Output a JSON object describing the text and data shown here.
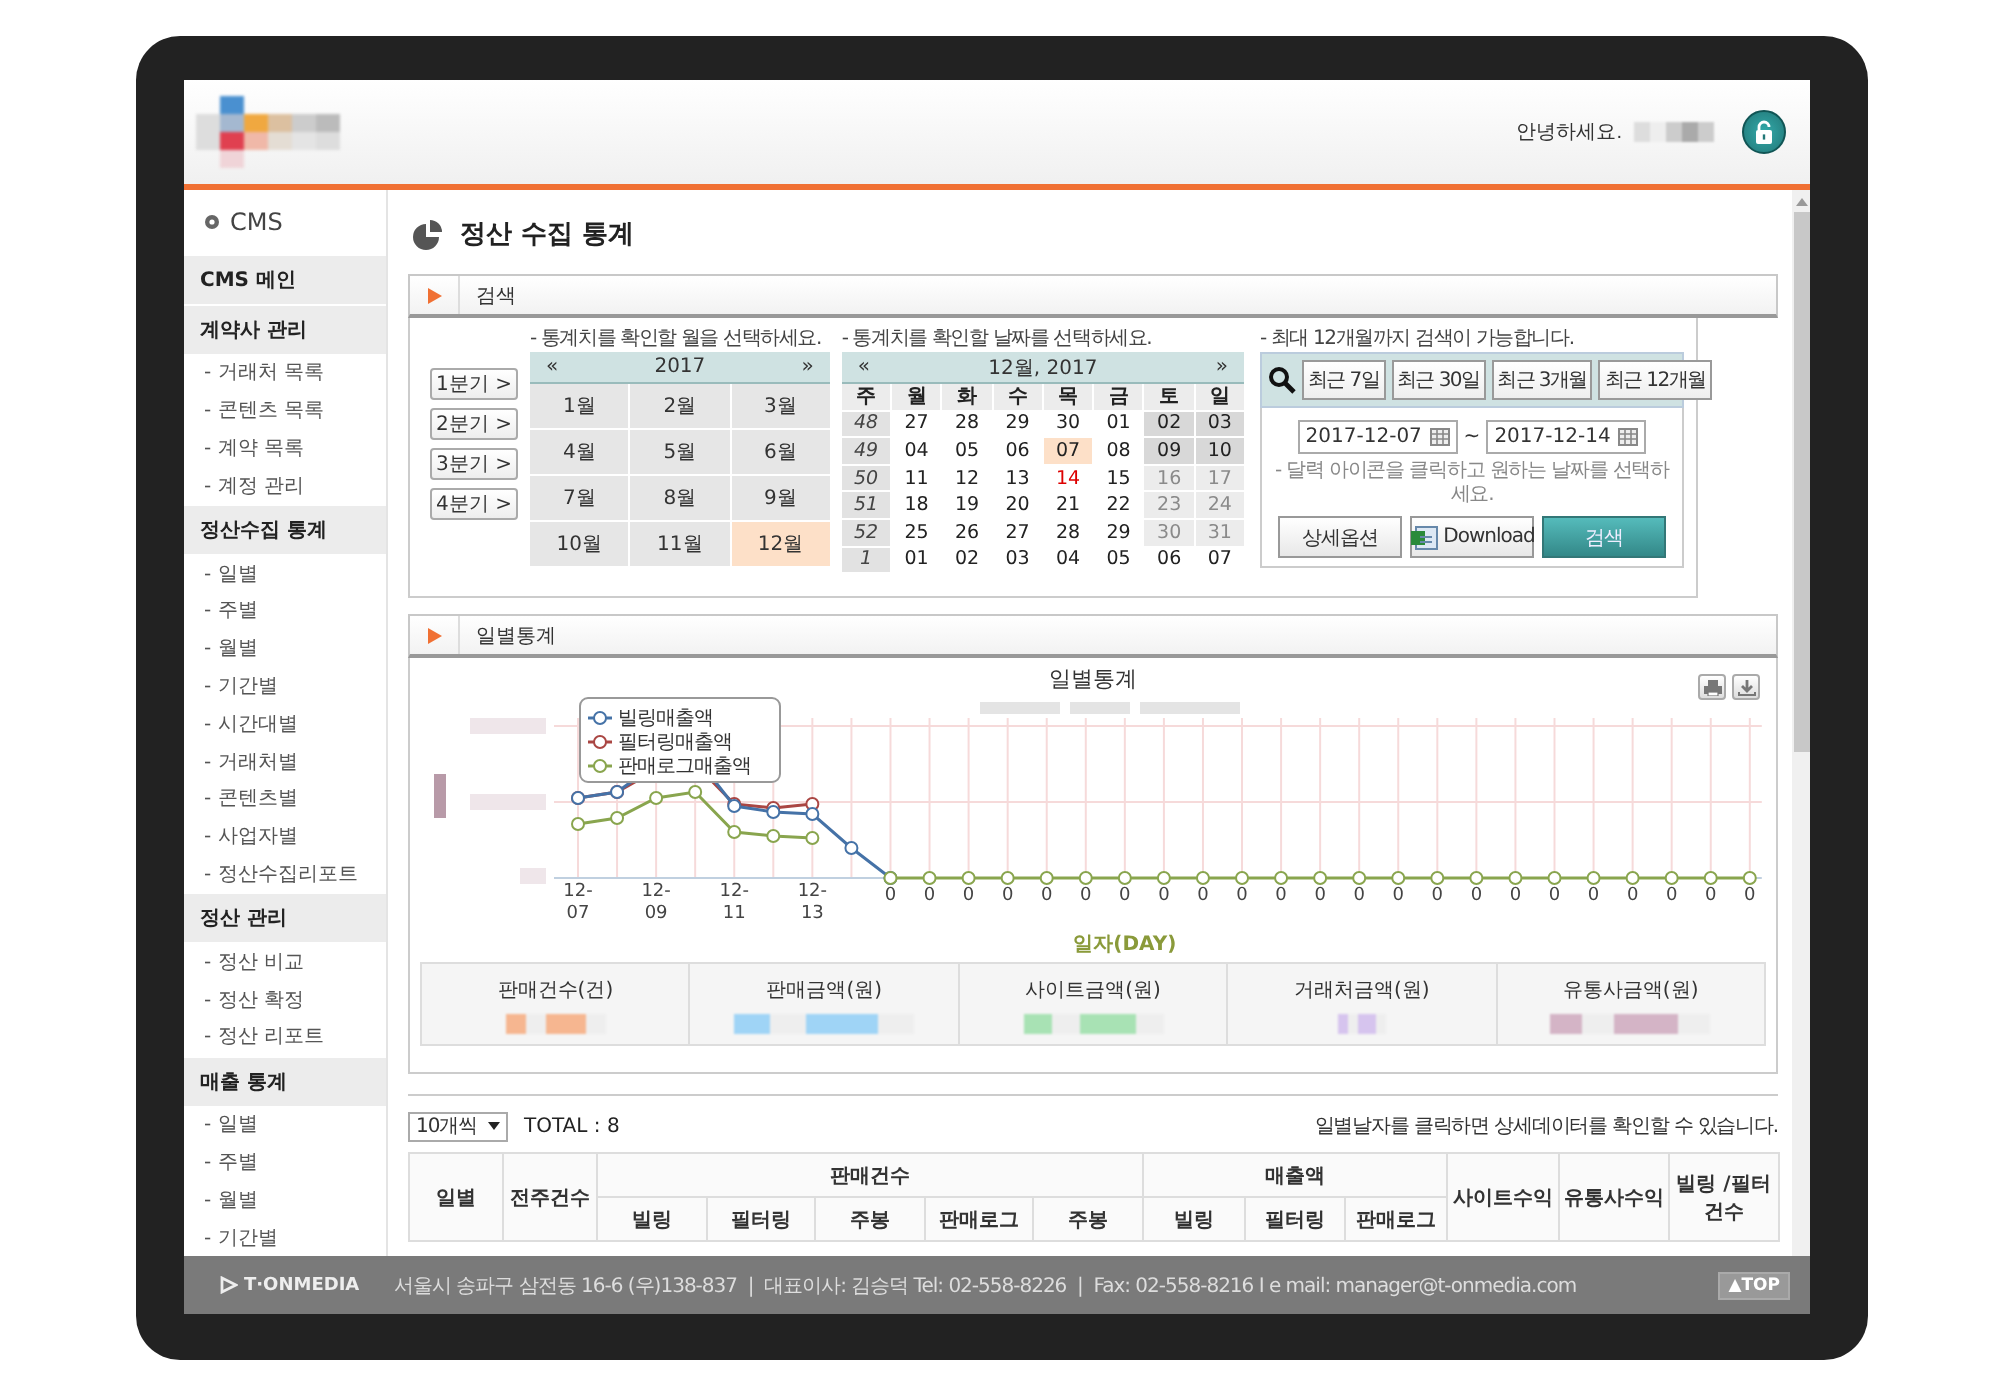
{
  "header": {
    "greeting": "안녕하세요."
  },
  "sidebar": {
    "title": "CMS",
    "sections": [
      {
        "label": "CMS 메인"
      },
      {
        "label": "계약사 관리",
        "children": [
          {
            "label": "- 거래처 목록"
          },
          {
            "label": "- 콘텐츠 목록"
          },
          {
            "label": "- 계약 목록"
          },
          {
            "label": "- 계정 관리"
          }
        ]
      },
      {
        "label": "정산수집 통계",
        "children": [
          {
            "label": "- 일별"
          },
          {
            "label": "- 주별"
          },
          {
            "label": "- 월별"
          },
          {
            "label": "- 기간별"
          },
          {
            "label": "- 시간대별"
          },
          {
            "label": "- 거래처별"
          },
          {
            "label": "- 콘텐츠별"
          },
          {
            "label": "- 사업자별"
          },
          {
            "label": "- 정산수집리포트"
          }
        ]
      },
      {
        "label": "정산 관리",
        "children": [
          {
            "label": "- 정산 비교"
          },
          {
            "label": "- 정산 확정"
          },
          {
            "label": "- 정산 리포트"
          }
        ]
      },
      {
        "label": "매출 통계",
        "children": [
          {
            "label": "- 일별"
          },
          {
            "label": "- 주별"
          },
          {
            "label": "- 월별"
          },
          {
            "label": "- 기간별"
          }
        ]
      }
    ]
  },
  "page_title": "정산 수집 통계",
  "search": {
    "title": "검색",
    "month_hint": "- 통계치를 확인할 월을 선택하세요.",
    "quarters": [
      "1분기 >",
      "2분기 >",
      "3분기 >",
      "4분기 >"
    ],
    "year_picker": {
      "prev": "«",
      "label": "2017",
      "next": "»"
    },
    "months": [
      {
        "label": "1월",
        "selected": false
      },
      {
        "label": "2월",
        "selected": false
      },
      {
        "label": "3월",
        "selected": false
      },
      {
        "label": "4월",
        "selected": false
      },
      {
        "label": "5월",
        "selected": false
      },
      {
        "label": "6월",
        "selected": false
      },
      {
        "label": "7월",
        "selected": false
      },
      {
        "label": "8월",
        "selected": false
      },
      {
        "label": "9월",
        "selected": false
      },
      {
        "label": "10월",
        "selected": false
      },
      {
        "label": "11월",
        "selected": false
      },
      {
        "label": "12월",
        "selected": true
      }
    ],
    "date_hint": "- 통계치를 확인할 날짜를 선택하세요.",
    "calendar": {
      "prev": "«",
      "label": "12월, 2017",
      "next": "»",
      "weekdays": [
        "주",
        "월",
        "화",
        "수",
        "목",
        "금",
        "토",
        "일"
      ],
      "weeks": [
        {
          "number": "48",
          "days": [
            {
              "label": "27",
              "kind": "day",
              "selected": false,
              "today": false
            },
            {
              "label": "28",
              "kind": "day",
              "selected": false,
              "today": false
            },
            {
              "label": "29",
              "kind": "day",
              "selected": false,
              "today": false
            },
            {
              "label": "30",
              "kind": "day",
              "selected": false,
              "today": false
            },
            {
              "label": "01",
              "kind": "day",
              "selected": false,
              "today": false
            },
            {
              "label": "02",
              "kind": "weekend",
              "selected": false,
              "today": false
            },
            {
              "label": "03",
              "kind": "weekend",
              "selected": false,
              "today": false
            }
          ]
        },
        {
          "number": "49",
          "days": [
            {
              "label": "04",
              "kind": "day",
              "selected": false,
              "today": false
            },
            {
              "label": "05",
              "kind": "day",
              "selected": false,
              "today": false
            },
            {
              "label": "06",
              "kind": "day",
              "selected": false,
              "today": false
            },
            {
              "label": "07",
              "kind": "day",
              "selected": true,
              "today": false
            },
            {
              "label": "08",
              "kind": "day",
              "selected": false,
              "today": false
            },
            {
              "label": "09",
              "kind": "weekend",
              "selected": false,
              "today": false
            },
            {
              "label": "10",
              "kind": "weekend",
              "selected": false,
              "today": false
            }
          ]
        },
        {
          "number": "50",
          "days": [
            {
              "label": "11",
              "kind": "day",
              "selected": false,
              "today": false
            },
            {
              "label": "12",
              "kind": "day",
              "selected": false,
              "today": false
            },
            {
              "label": "13",
              "kind": "day",
              "selected": false,
              "today": false
            },
            {
              "label": "14",
              "kind": "day",
              "selected": false,
              "today": true
            },
            {
              "label": "15",
              "kind": "day",
              "selected": false,
              "today": false
            },
            {
              "label": "16",
              "kind": "disabled",
              "selected": false,
              "today": false
            },
            {
              "label": "17",
              "kind": "disabled",
              "selected": false,
              "today": false
            }
          ]
        },
        {
          "number": "51",
          "days": [
            {
              "label": "18",
              "kind": "day",
              "selected": false,
              "today": false
            },
            {
              "label": "19",
              "kind": "day",
              "selected": false,
              "today": false
            },
            {
              "label": "20",
              "kind": "day",
              "selected": false,
              "today": false
            },
            {
              "label": "21",
              "kind": "day",
              "selected": false,
              "today": false
            },
            {
              "label": "22",
              "kind": "day",
              "selected": false,
              "today": false
            },
            {
              "label": "23",
              "kind": "disabled",
              "selected": false,
              "today": false
            },
            {
              "label": "24",
              "kind": "disabled",
              "selected": false,
              "today": false
            }
          ]
        },
        {
          "number": "52",
          "days": [
            {
              "label": "25",
              "kind": "day",
              "selected": false,
              "today": false
            },
            {
              "label": "26",
              "kind": "day",
              "selected": false,
              "today": false
            },
            {
              "label": "27",
              "kind": "day",
              "selected": false,
              "today": false
            },
            {
              "label": "28",
              "kind": "day",
              "selected": false,
              "today": false
            },
            {
              "label": "29",
              "kind": "day",
              "selected": false,
              "today": false
            },
            {
              "label": "30",
              "kind": "disabled",
              "selected": false,
              "today": false
            },
            {
              "label": "31",
              "kind": "disabled",
              "selected": false,
              "today": false
            }
          ]
        },
        {
          "number": "1",
          "days": [
            {
              "label": "01",
              "kind": "day",
              "selected": false,
              "today": false
            },
            {
              "label": "02",
              "kind": "day",
              "selected": false,
              "today": false
            },
            {
              "label": "03",
              "kind": "day",
              "selected": false,
              "today": false
            },
            {
              "label": "04",
              "kind": "day",
              "selected": false,
              "today": false
            },
            {
              "label": "05",
              "kind": "day",
              "selected": false,
              "today": false
            },
            {
              "label": "06",
              "kind": "day",
              "selected": false,
              "today": false
            },
            {
              "label": "07",
              "kind": "day",
              "selected": false,
              "today": false
            }
          ]
        }
      ]
    },
    "range_hint": "- 최대 12개월까지 검색이 가능합니다.",
    "presets": [
      "최근 7일",
      "최근 30일",
      "최근 3개월",
      "최근 12개월"
    ],
    "start_date": "2017-12-07",
    "separator": "~",
    "end_date": "2017-12-14",
    "picker_hint": "- 달력 아이콘을 클릭하고 원하는 날짜를 선택하세요.",
    "buttons": [
      {
        "label": "상세옵션",
        "kind": "plain"
      },
      {
        "label": "Download",
        "kind": "download"
      },
      {
        "label": "검색",
        "kind": "primary"
      }
    ]
  },
  "daily_stats": {
    "title": "일별통계",
    "chart": {
      "title": "일별통계",
      "legend": [
        {
          "name": "빌링매출액",
          "color": "#4572a7"
        },
        {
          "name": "필터링매출액",
          "color": "#aa4643"
        },
        {
          "name": "판매로그매출액",
          "color": "#89a54e"
        }
      ],
      "x_labels": [
        "12-07",
        "12-09",
        "12-11",
        "12-13"
      ],
      "point_labels": [
        "0",
        "0",
        "0",
        "0",
        "0",
        "0",
        "0",
        "0",
        "0",
        "0",
        "0",
        "0",
        "0",
        "0",
        "0",
        "0",
        "0",
        "0",
        "0",
        "0",
        "0",
        "0",
        "0"
      ],
      "xlabel": "일자(DAY)"
    },
    "summary": [
      {
        "label": "판매건수(건)",
        "color": "#f6b690"
      },
      {
        "label": "판매금액(원)",
        "color": "#9fd4f6"
      },
      {
        "label": "사이트금액(원)",
        "color": "#a8e2b4"
      },
      {
        "label": "거래처금액(원)",
        "color": "#d6c4ee"
      },
      {
        "label": "유통사금액(원)",
        "color": "#d4b4c6"
      }
    ]
  },
  "table": {
    "page_size": "10개씩",
    "total": "TOTAL : 8",
    "hint": "일별날자를 클릭하면 상세데이터를 확인할 수 있습니다.",
    "columns": [
      {
        "label": "일별"
      },
      {
        "label": "전주건수"
      },
      {
        "label": "판매건수",
        "children": [
          {
            "label": "빌링"
          },
          {
            "label": "필터링"
          },
          {
            "label": "주봉"
          },
          {
            "label": "판매로그"
          },
          {
            "label": "주봉"
          }
        ]
      },
      {
        "label": "매출액",
        "children": [
          {
            "label": "빌링"
          },
          {
            "label": "필터링"
          },
          {
            "label": "판매로그"
          }
        ]
      },
      {
        "label": "사이트수익"
      },
      {
        "label": "유통사수익"
      },
      {
        "label": "빌링 /필터건수"
      }
    ]
  },
  "footer": {
    "brand": "T·ONMEDIA",
    "address": "서울시 송파구 삼전동 16-6 (우)138-837  |  대표이사: 김승덕 Tel: 02-558-8226  |  Fax: 02-558-8216 I e mail: manager@t-onmedia.com",
    "top": "▲TOP"
  }
}
